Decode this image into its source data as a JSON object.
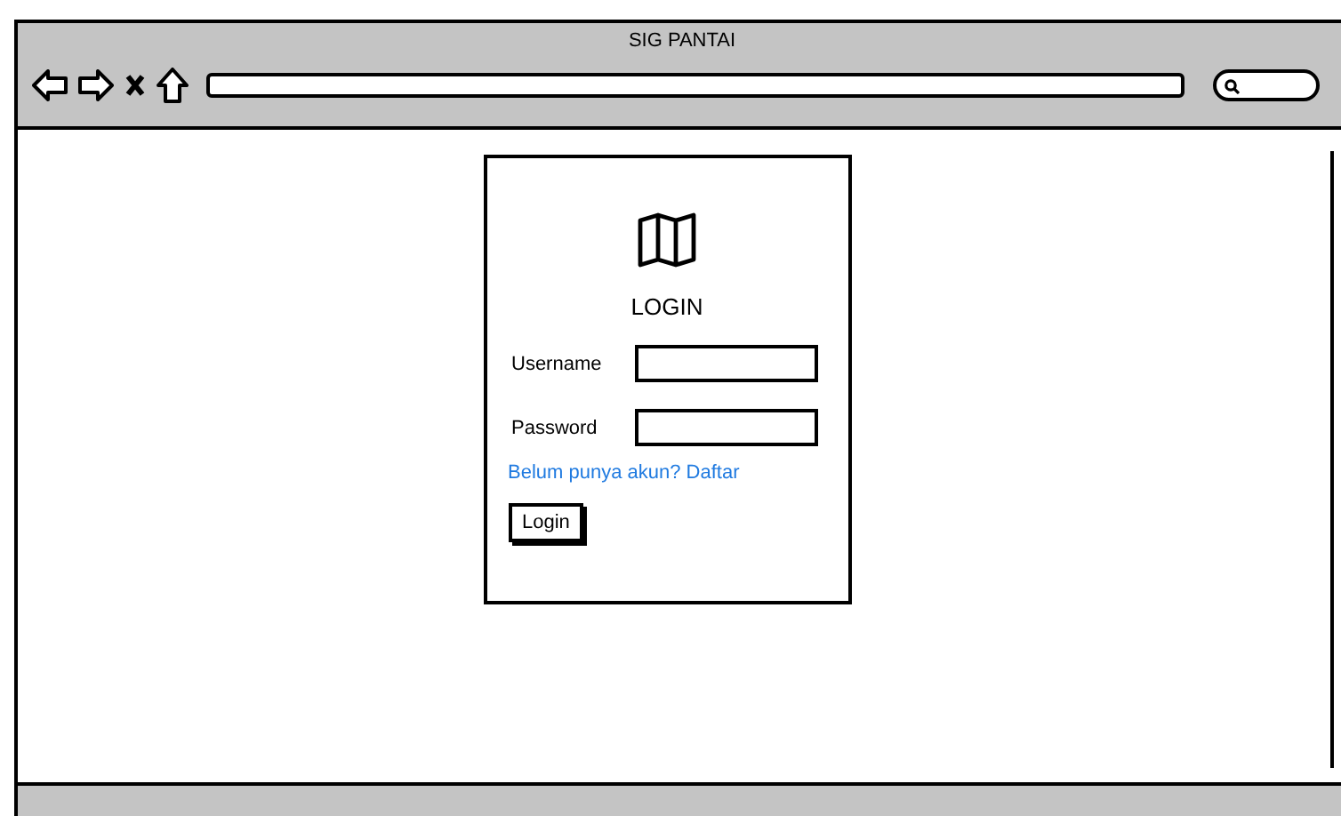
{
  "window": {
    "title": "SIG PANTAI"
  },
  "login": {
    "title": "LOGIN",
    "fields": [
      {
        "label": "Username"
      },
      {
        "label": "Password"
      }
    ],
    "link": "Belum punya akun? Daftar",
    "button": "Login"
  }
}
